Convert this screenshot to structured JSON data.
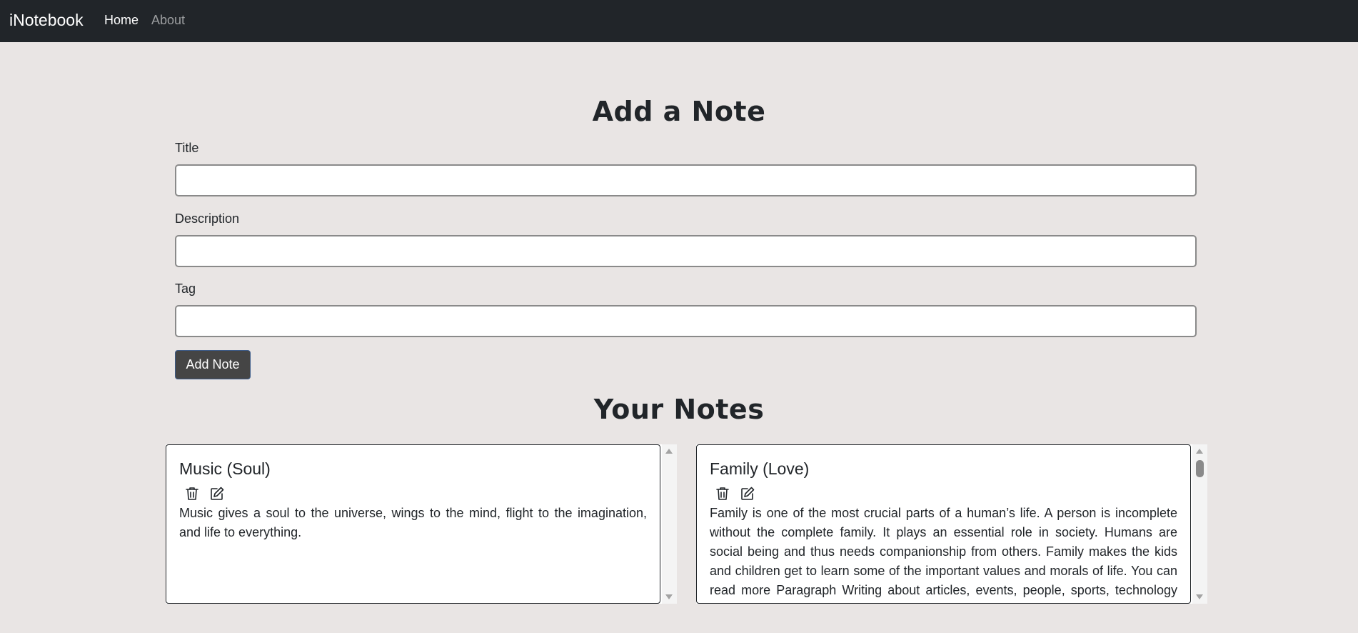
{
  "navbar": {
    "brand": "iNotebook",
    "links": [
      {
        "label": "Home",
        "active": true
      },
      {
        "label": "About",
        "active": false
      }
    ]
  },
  "add_note": {
    "heading": "Add a Note",
    "fields": {
      "title_label": "Title",
      "title_value": "",
      "description_label": "Description",
      "description_value": "",
      "tag_label": "Tag",
      "tag_value": ""
    },
    "submit_label": "Add Note"
  },
  "notes_section": {
    "heading": "Your Notes",
    "notes": [
      {
        "title": "Music (Soul)",
        "description": "Music gives a soul to the universe, wings to the mind, flight to the imagination, and life to everything.",
        "actions": [
          "trash-icon",
          "edit-icon"
        ]
      },
      {
        "title": "Family (Love)",
        "description": "Family is one of the most crucial parts of a human’s life. A person is incomplete without the complete family. It plays an essential role in society. Humans are social being and thus needs companionship from others. Family makes the kids and children get to learn some of the important values and morals of life. You can read more Paragraph Writing about articles, events, people, sports, technology many",
        "actions": [
          "trash-icon",
          "edit-icon"
        ]
      }
    ]
  },
  "colors": {
    "navbar_bg": "#212529",
    "page_bg": "#e9e5e4",
    "button_bg": "#454545"
  }
}
